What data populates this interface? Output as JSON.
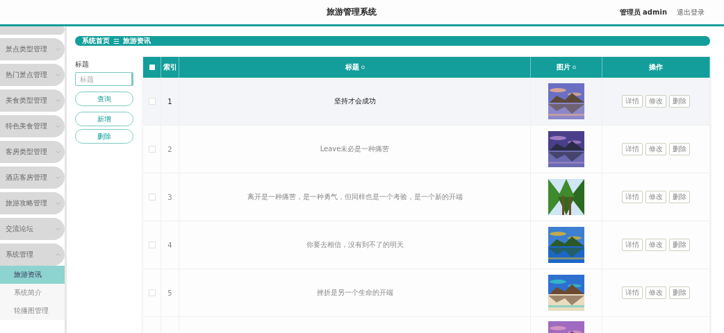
{
  "header": {
    "title": "旅游管理系统",
    "user": "管理员 admin",
    "logout": "退出登录"
  },
  "sidebar": {
    "items": [
      {
        "label": "景点类型管理",
        "expanded": false
      },
      {
        "label": "热门景点管理",
        "expanded": false
      },
      {
        "label": "美食类型管理",
        "expanded": false
      },
      {
        "label": "特色美食管理",
        "expanded": false
      },
      {
        "label": "客房类型管理",
        "expanded": false
      },
      {
        "label": "酒店客房管理",
        "expanded": false
      },
      {
        "label": "旅游攻略管理",
        "expanded": false
      },
      {
        "label": "交流论坛",
        "expanded": false
      },
      {
        "label": "系统管理",
        "expanded": true,
        "children": [
          {
            "label": "旅游资讯",
            "selected": true
          },
          {
            "label": "系统简介",
            "selected": false
          },
          {
            "label": "轮播图管理",
            "selected": false
          }
        ]
      }
    ]
  },
  "breadcrumb": {
    "home": "系统首页",
    "separator": "☰",
    "current": "旅游资讯"
  },
  "search": {
    "label": "标题",
    "placeholder": "标题",
    "buttons": [
      "查询",
      "新增",
      "删除"
    ]
  },
  "table": {
    "all_checked": false,
    "columns": [
      {
        "label": "索引",
        "sortable": false
      },
      {
        "label": "标题",
        "sortable": true
      },
      {
        "label": "图片",
        "sortable": true
      },
      {
        "label": "操作",
        "sortable": false
      }
    ],
    "rows": [
      {
        "index": "1",
        "title": "坚持才会成功",
        "image": {
          "kind": "picture"
        },
        "actions": [
          "详情",
          "修改",
          "删除"
        ],
        "checked": false,
        "highlighted": true
      },
      {
        "index": "2",
        "title": "Leave未必是一种痛苦",
        "image": {
          "kind": "picture"
        },
        "actions": [
          "详情",
          "修改",
          "删除"
        ],
        "checked": false,
        "highlighted": false
      },
      {
        "index": "3",
        "title": "离开是一种痛苦，是一种勇气，但同样也是一个考验，是一个新的开端",
        "image": {
          "kind": "picture"
        },
        "actions": [
          "详情",
          "修改",
          "删除"
        ],
        "checked": false,
        "highlighted": false
      },
      {
        "index": "4",
        "title": "你要去相信，没有到不了的明天",
        "image": {
          "kind": "picture"
        },
        "actions": [
          "详情",
          "修改",
          "删除"
        ],
        "checked": false,
        "highlighted": false
      },
      {
        "index": "5",
        "title": "挫折是另一个生命的开端",
        "image": {
          "kind": "picture"
        },
        "actions": [
          "详情",
          "修改",
          "删除"
        ],
        "checked": false,
        "highlighted": false
      },
      {
        "image": {
          "kind": "picture"
        }
      }
    ]
  }
}
